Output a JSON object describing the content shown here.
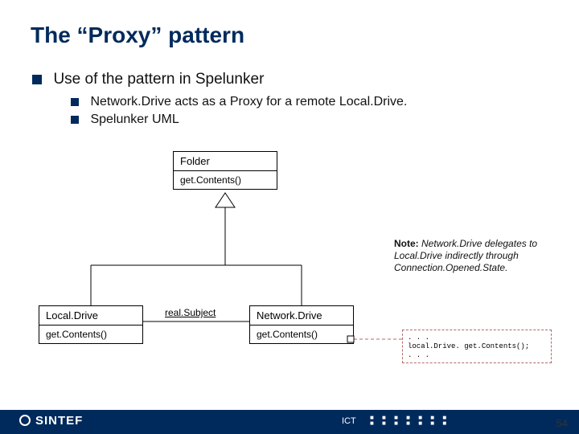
{
  "title": "The “Proxy” pattern",
  "bullets": {
    "l1": "Use of the pattern in Spelunker",
    "l2a": "Network.Drive acts as a Proxy for a remote Local.Drive.",
    "l2b": "Spelunker UML"
  },
  "uml": {
    "folder": {
      "name": "Folder",
      "op": "get.Contents()"
    },
    "local": {
      "name": "Local.Drive",
      "op": "get.Contents()"
    },
    "network": {
      "name": "Network.Drive",
      "op": "get.Contents()"
    }
  },
  "assoc_label": "real.Subject",
  "note": {
    "heading": "Note:",
    "body": "Network.Drive delegates to Local.Drive indirectly through Connection.Opened.State."
  },
  "code": {
    "l1": ". . .",
    "l2": "local.Drive. get.Contents();",
    "l3": ". . ."
  },
  "footer": {
    "brand": "SINTEF",
    "dept": "ICT"
  },
  "page_number": "54"
}
